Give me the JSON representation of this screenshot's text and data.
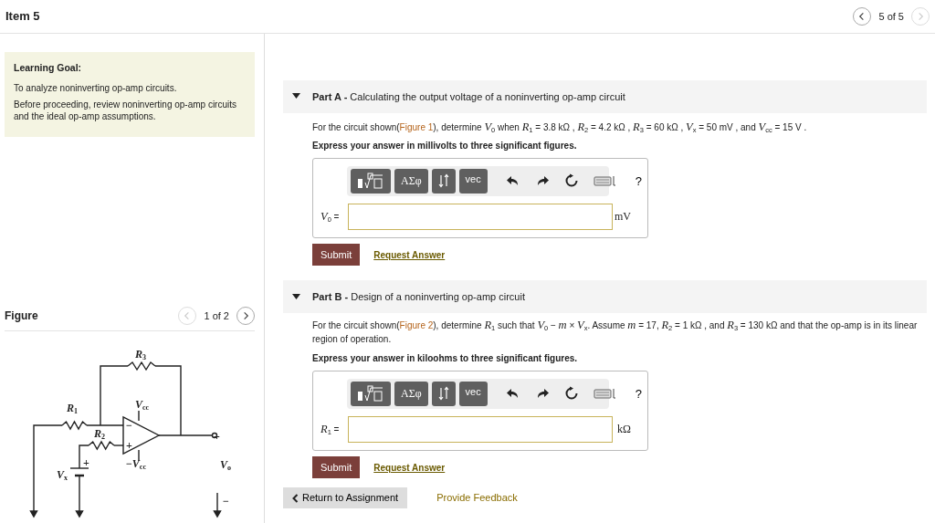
{
  "header": {
    "title": "Item 5",
    "pager": {
      "label": "5 of 5",
      "prev_disabled": false,
      "next_disabled": true
    }
  },
  "learning_goal": {
    "heading": "Learning Goal:",
    "paragraphs": [
      "To analyze noninverting op-amp circuits.",
      "Before proceeding, review noninverting op-amp circuits and the ideal op-amp assumptions."
    ]
  },
  "figure": {
    "heading": "Figure",
    "pager": {
      "label": "1 of 2",
      "prev_disabled": true,
      "next_disabled": false
    },
    "labels": [
      {
        "text": "*R*$_{3}$"
      },
      {
        "text": "*R*$_{1}$"
      },
      {
        "text": "*V*$_{cc}$"
      },
      {
        "text": "*R*$_{2}$"
      },
      {
        "text": "−"
      },
      {
        "text": "+"
      },
      {
        "text": "+"
      },
      {
        "text": "−*V*$_{cc}$"
      },
      {
        "text": "*V*$_{x}$"
      },
      {
        "text": "+"
      },
      {
        "text": "*V*$_{o}$"
      },
      {
        "text": "−"
      }
    ]
  },
  "parts": [
    {
      "label": "Part A -",
      "title": "Calculating the output voltage of a noninverting op-amp circuit",
      "expanded": true,
      "statement_before": "For the circuit shown(",
      "figure_link": "Figure 1",
      "statement_after": "), determine *V*$_{0}$ when *R*$_{1}$ = 3.8 kΩ , *R*$_{2}$ = 4.2 kΩ , *R*$_{3}$ = 60 kΩ , *V*$_{x}$ = 50 mV , and *V*$_{cc}$ = 15 V .",
      "instruction": "Express your answer in millivolts to three significant figures.",
      "toolbar": {
        "symbols_label": "ΑΣφ",
        "vector_label": "vec",
        "help_label": "?"
      },
      "answer_label": "*V*$_{0}$ =",
      "unit": "mV",
      "submit": "Submit",
      "request": "Request Answer"
    },
    {
      "label": "Part B -",
      "title": "Design of a noninverting op-amp circuit",
      "expanded": true,
      "statement_before": "For the circuit shown(",
      "figure_link": "Figure 2",
      "statement_after": "), determine *R*$_{1}$ such that *V*$_{0}$ − *m* × *V*$_{x}$. Assume *m* = 17, *R*$_{2}$ = 1 kΩ , and *R*$_{3}$ = 130 kΩ and that the op-amp is in its linear region of operation.",
      "instruction": "Express your answer in kiloohms to three significant figures.",
      "toolbar": {
        "symbols_label": "ΑΣφ",
        "vector_label": "vec",
        "help_label": "?"
      },
      "answer_label": "*R*$_{1}$ =",
      "unit": "kΩ",
      "submit": "Submit",
      "request": "Request Answer"
    }
  ],
  "footer": {
    "return_label": "Return to Assignment",
    "feedback_label": "Provide Feedback"
  }
}
